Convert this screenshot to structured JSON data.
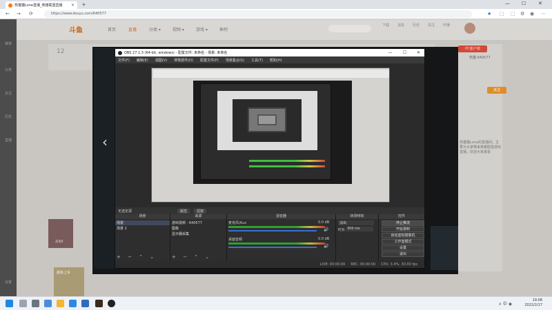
{
  "browser": {
    "tab_title": "热猫猫Lone直播_英雄联盟直播",
    "tab_close": "×",
    "new_tab": "+",
    "url": "https://www.douyu.com/640577",
    "back": "←",
    "forward": "→",
    "reload": "⟳",
    "window_min": "—",
    "window_max": "☐",
    "window_close": "✕",
    "star": "★",
    "ext_icons": [
      "⬚",
      "⬚",
      "⚙",
      "◉",
      "⋯"
    ]
  },
  "site": {
    "logo": "斗鱼",
    "nav": [
      "首页",
      "直播",
      "分类 ▾",
      "视频 ▾",
      "游戏 ▾",
      "鱼吧"
    ],
    "search_placeholder": "",
    "top_icons": [
      "下载",
      "消息",
      "历史",
      "关注",
      "开播"
    ],
    "room_level": "12",
    "side_nav": [
      "推荐",
      "分类",
      "关注",
      "历史",
      "直播",
      "设置"
    ],
    "follow_label": "关注",
    "lol_badge": "PC客户端",
    "room_number_text": "热猫 640577",
    "right_desc": "热猫猫Lone的直播间。主要为大家带来英雄联盟游戏直播，欢迎大家来看",
    "gift_price": "2/10",
    "gift_label_2": "超级上车"
  },
  "obs": {
    "title": "OBS 27.1.3 (64-bit, windows) - 配置文件: 未命名 - 场景: 未命名",
    "menu": [
      "文件(F)",
      "编辑(E)",
      "视图(V)",
      "停靠部件(D)",
      "配置文件(P)",
      "场景集合(S)",
      "工具(T)",
      "帮助(H)"
    ],
    "scene_bar": {
      "label": "无选定源",
      "props_btn": "属性",
      "filters_btn": "滤镜"
    },
    "docks": {
      "scenes": {
        "header": "场景",
        "items": [
          "场景",
          "场景 2"
        ]
      },
      "sources": {
        "header": "来源",
        "items": [
          "游戏视频 - 640577",
          "图像",
          "显示器采集"
        ]
      },
      "mixer": {
        "header": "混音器",
        "channels": [
          {
            "name": "麦克风/Aux",
            "level": "0.0 dB"
          },
          {
            "name": "桌面音频",
            "level": "0.0 dB"
          }
        ]
      },
      "transitions": {
        "header": "转场特效",
        "type": "淡出",
        "duration_label": "时长",
        "duration": "300 ms"
      },
      "controls": {
        "header": "控件",
        "buttons": [
          "停止推流",
          "开始录制",
          "启动虚拟摄像机",
          "工作室模式",
          "设置",
          "退出"
        ]
      }
    },
    "status": {
      "live": "LIVE: 00:00:00",
      "rec": "REC: 00:00:00",
      "cpu": "CPU: 3.4%, 30.00 fps"
    },
    "dock_footer": "+ − ⌃ ⌄"
  },
  "taskbar": {
    "clock_time": "19:08",
    "clock_date": "2022/2/17",
    "tray": "∧ 中 ◉"
  }
}
